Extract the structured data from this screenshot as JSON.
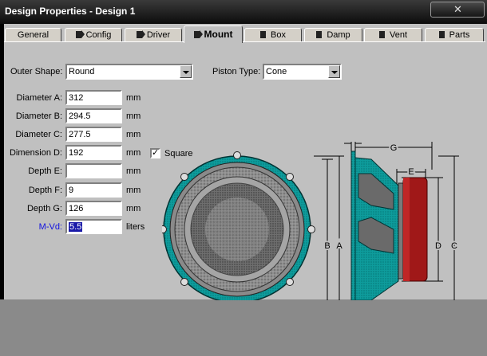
{
  "window": {
    "title": "Design Properties - Design 1"
  },
  "tabs": [
    {
      "label": "General",
      "icon": "none"
    },
    {
      "label": "Config",
      "icon": "speaker-icon"
    },
    {
      "label": "Driver",
      "icon": "speaker-icon"
    },
    {
      "label": "Mount",
      "icon": "speaker-icon",
      "active": true
    },
    {
      "label": "Box",
      "icon": "box-icon"
    },
    {
      "label": "Damp",
      "icon": "box-icon"
    },
    {
      "label": "Vent",
      "icon": "box-icon"
    },
    {
      "label": "Parts",
      "icon": "box-icon"
    }
  ],
  "mount": {
    "outer_shape_label": "Outer Shape:",
    "outer_shape_value": "Round",
    "piston_type_label": "Piston Type:",
    "piston_type_value": "Cone",
    "square_label": "Square",
    "square_checked": "✓",
    "fields": [
      {
        "label": "Diameter A:",
        "value": "312",
        "unit": "mm"
      },
      {
        "label": "Diameter B:",
        "value": "294.5",
        "unit": "mm"
      },
      {
        "label": "Diameter C:",
        "value": "277.5",
        "unit": "mm"
      },
      {
        "label": "Dimension D:",
        "value": "192",
        "unit": "mm"
      },
      {
        "label": "Depth E:",
        "value": "",
        "unit": "mm"
      },
      {
        "label": "Depth F:",
        "value": "9",
        "unit": "mm"
      },
      {
        "label": "Depth G:",
        "value": "126",
        "unit": "mm"
      },
      {
        "label": "M-Vd:",
        "value": "5.5",
        "unit": "liters"
      }
    ]
  },
  "diagram": {
    "labels": {
      "A": "A",
      "B": "B",
      "C": "C",
      "D": "D",
      "E": "E",
      "F": "F",
      "G": "G"
    },
    "colors": {
      "frame": "#0e9c9c",
      "magnet": "#a01818",
      "cone": "#9a9a9a"
    }
  }
}
